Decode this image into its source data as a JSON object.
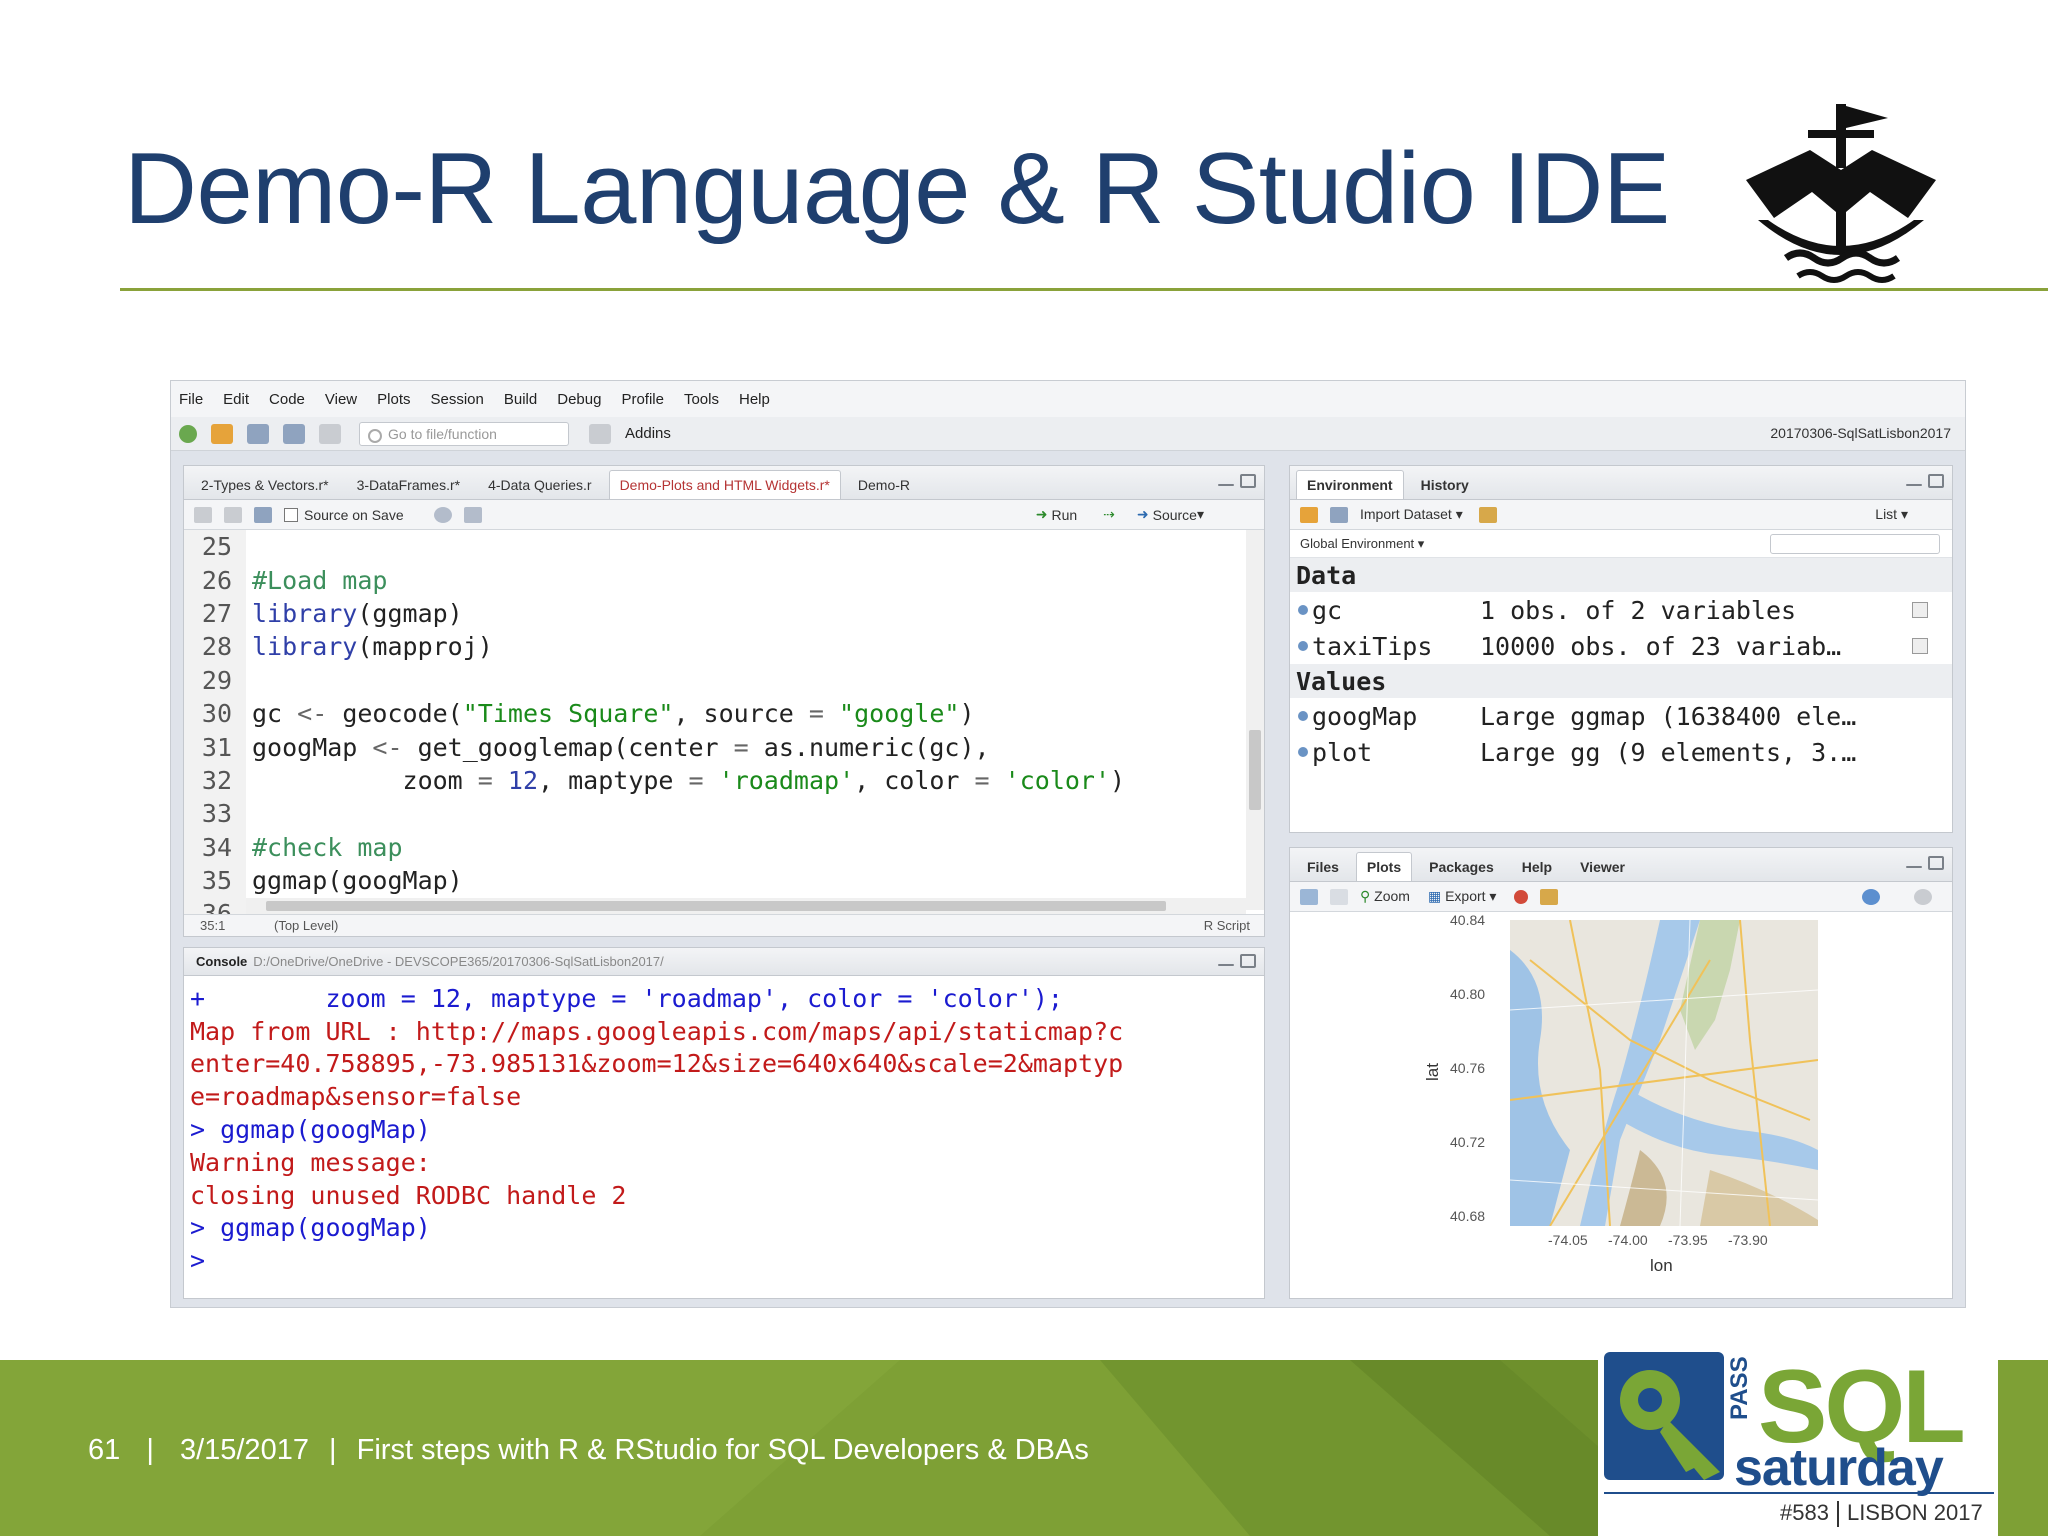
{
  "slide": {
    "title": "Demo-R Language & R Studio IDE",
    "footer": {
      "page": "61",
      "date": "3/15/2017",
      "talk": "First steps with R & RStudio for SQL Developers & DBAs",
      "separator": "|"
    },
    "sponsor_logo": {
      "sql": "SQL",
      "pass": "PASS",
      "saturday": "saturday",
      "event_number": "#583",
      "event_city": "LISBON 2017"
    },
    "colors": {
      "title": "#1f3f6e",
      "rule": "#8aa23a",
      "footer_green": "#7ea035"
    }
  },
  "rstudio": {
    "menu": [
      "File",
      "Edit",
      "Code",
      "View",
      "Plots",
      "Session",
      "Build",
      "Debug",
      "Profile",
      "Tools",
      "Help"
    ],
    "toolbar": {
      "goto_placeholder": "Go to file/function",
      "addins": "Addins",
      "project": "20170306-SqlSatLisbon2017"
    },
    "editor": {
      "tabs": [
        "2-Types & Vectors.r*",
        "3-DataFrames.r*",
        "4-Data Queries.r",
        "Demo-Plots and HTML Widgets.r*",
        "Demo-R"
      ],
      "active_tab_index": 3,
      "source_on_save": "Source on Save",
      "run": "Run",
      "source": "Source",
      "lines": [
        {
          "n": "25",
          "text": ""
        },
        {
          "n": "26",
          "text": "#Load map"
        },
        {
          "n": "27",
          "text": "library(ggmap)"
        },
        {
          "n": "28",
          "text": "library(mapproj)"
        },
        {
          "n": "29",
          "text": ""
        },
        {
          "n": "30",
          "text": "gc <- geocode(\"Times Square\", source = \"google\")"
        },
        {
          "n": "31",
          "text": "googMap <- get_googlemap(center = as.numeric(gc),"
        },
        {
          "n": "32",
          "text": "          zoom = 12, maptype = 'roadmap', color = 'color')"
        },
        {
          "n": "33",
          "text": ""
        },
        {
          "n": "34",
          "text": "#check map"
        },
        {
          "n": "35",
          "text": "ggmap(googMap)"
        },
        {
          "n": "36",
          "text": ""
        }
      ],
      "status_pos": "35:1",
      "status_level": "(Top Level)",
      "status_type": "R Script"
    },
    "console": {
      "label": "Console",
      "path": "D:/OneDrive/OneDrive - DEVSCOPE365/20170306-SqlSatLisbon2017/",
      "lines": [
        {
          "kind": "cont",
          "text": "+        zoom = 12, maptype = 'roadmap', color = 'color');"
        },
        {
          "kind": "msg",
          "text": "Map from URL : http://maps.googleapis.com/maps/api/staticmap?c"
        },
        {
          "kind": "msg",
          "text": "enter=40.758895,-73.985131&zoom=12&size=640x640&scale=2&maptyp"
        },
        {
          "kind": "msg",
          "text": "e=roadmap&sensor=false"
        },
        {
          "kind": "prompt",
          "text": "> ggmap(googMap)"
        },
        {
          "kind": "msg",
          "text": "Warning message:"
        },
        {
          "kind": "msg",
          "text": "closing unused RODBC handle 2"
        },
        {
          "kind": "prompt",
          "text": "> ggmap(googMap)"
        },
        {
          "kind": "prompt",
          "text": "> "
        }
      ]
    },
    "environment": {
      "tabs": [
        "Environment",
        "History"
      ],
      "import_dataset": "Import Dataset",
      "list_view": "List",
      "scope": "Global Environment",
      "data_header": "Data",
      "values_header": "Values",
      "data": [
        {
          "name": "gc",
          "value": "1 obs. of 2 variables"
        },
        {
          "name": "taxiTips",
          "value": "10000 obs. of 23 variab…"
        }
      ],
      "values": [
        {
          "name": "googMap",
          "value": "Large ggmap (1638400 ele…"
        },
        {
          "name": "plot",
          "value": "Large gg (9 elements, 3.…"
        }
      ]
    },
    "plots": {
      "tabs": [
        "Files",
        "Plots",
        "Packages",
        "Help",
        "Viewer"
      ],
      "zoom": "Zoom",
      "export": "Export",
      "y_ticks": [
        "40.84",
        "40.80",
        "40.76",
        "40.72",
        "40.68"
      ],
      "x_ticks": [
        "-74.05",
        "-74.00",
        "-73.95",
        "-73.90"
      ],
      "xlabel": "lon",
      "ylabel": "lat"
    }
  }
}
